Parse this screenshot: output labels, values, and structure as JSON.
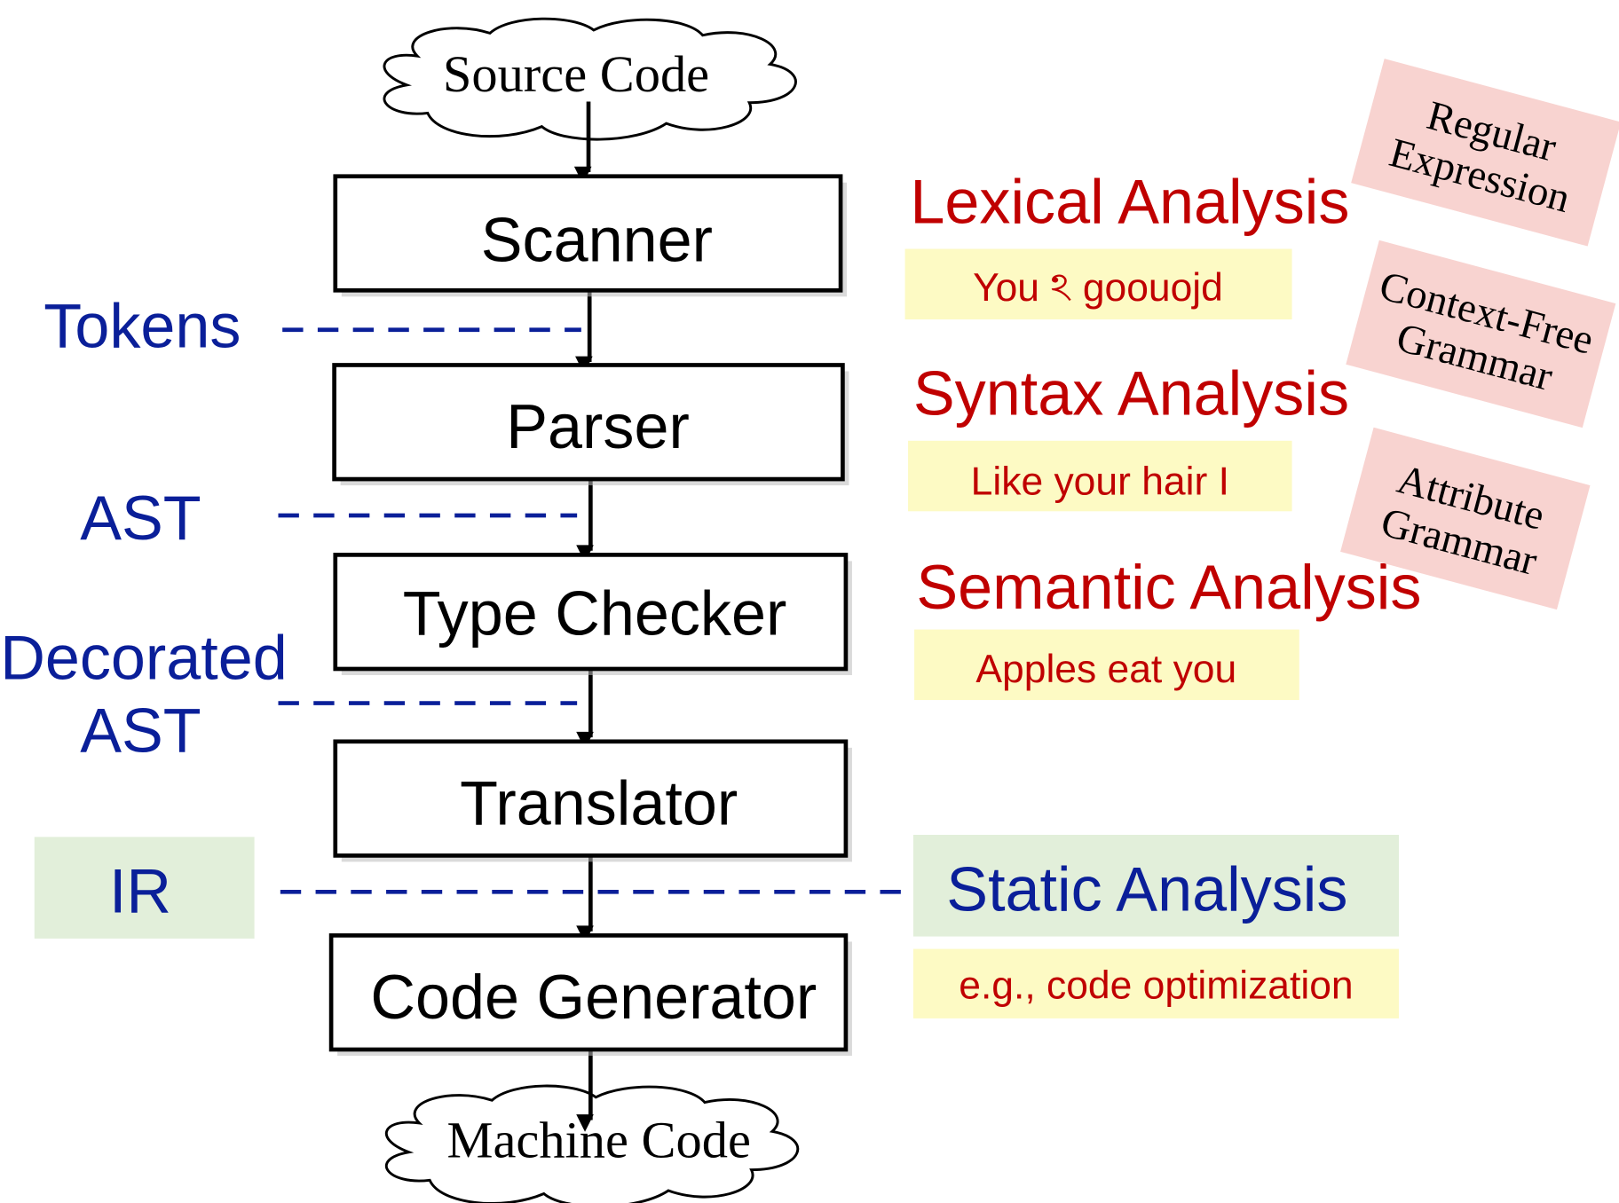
{
  "colors": {
    "stage_label": "#c00000",
    "artifact_label": "#0a1f99",
    "example_bg": "#fdfac4",
    "ir_bg": "#e2efda",
    "formalism_bg": "#f8d3d0"
  },
  "input": "Source Code",
  "output": "Machine Code",
  "stages": [
    {
      "name": "Scanner"
    },
    {
      "name": "Parser"
    },
    {
      "name": "Type Checker"
    },
    {
      "name": "Translator"
    },
    {
      "name": "Code Generator"
    }
  ],
  "artifacts": {
    "tokens": "Tokens",
    "ast": "AST",
    "decorated_line1": "Decorated",
    "decorated_line2": "AST",
    "ir": "IR"
  },
  "analyses": [
    {
      "title": "Lexical Analysis",
      "example": "You ঽ goouojd"
    },
    {
      "title": "Syntax Analysis",
      "example": "Like your hair I"
    },
    {
      "title": "Semantic Analysis",
      "example": "Apples eat you"
    },
    {
      "title": "Static Analysis",
      "example": "e.g., code optimization"
    }
  ],
  "formalisms": [
    {
      "line1": "Regular",
      "line2": "Expression"
    },
    {
      "line1": "Context-Free",
      "line2": "Grammar"
    },
    {
      "line1": "Attribute",
      "line2": "Grammar"
    }
  ]
}
